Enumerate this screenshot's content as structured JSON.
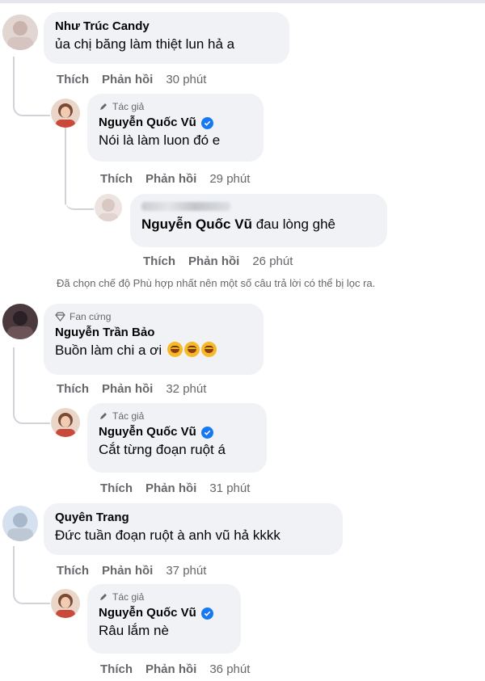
{
  "actions": {
    "like": "Thích",
    "reply": "Phản hồi"
  },
  "colors": {
    "verified": "#1877f2",
    "bubble": "#f0f2f5",
    "meta": "#65676b"
  },
  "filter_notice": "Đã chọn chế độ Phù hợp nhất nên một số câu trả lời có thể bị lọc ra.",
  "comments": [
    {
      "name": "Như Trúc Candy",
      "text": "ủa chị băng làm thiệt lun hả a",
      "time": "30 phút",
      "reply": {
        "badge": "Tác giả",
        "badge_icon": "pencil-icon",
        "name": "Nguyễn Quốc Vũ",
        "verified": true,
        "text": "Nói là làm luon đó e",
        "time": "29 phút",
        "reply": {
          "name_blurred": true,
          "mention": "Nguyễn Quốc Vũ",
          "text": " đau lòng ghê",
          "time": "26 phút"
        }
      }
    },
    {
      "badge": "Fan cứng",
      "badge_icon": "diamond-icon",
      "name": "Nguyễn Trần Bảo",
      "text": "Buồn làm chi a ơi",
      "emoji_count": 3,
      "time": "32 phút",
      "reply": {
        "badge": "Tác giả",
        "name": "Nguyễn Quốc Vũ",
        "verified": true,
        "text": "Cắt từng đoạn ruột á",
        "time": "31 phút"
      }
    },
    {
      "name": "Quyên Trang",
      "text": "Đức tuần đoạn ruột à anh vũ hả kkkk",
      "time": "37 phút",
      "reply": {
        "badge": "Tác giả",
        "name": "Nguyễn Quốc Vũ",
        "verified": true,
        "text": "Râu lắm nè",
        "time": "36 phút"
      }
    }
  ]
}
